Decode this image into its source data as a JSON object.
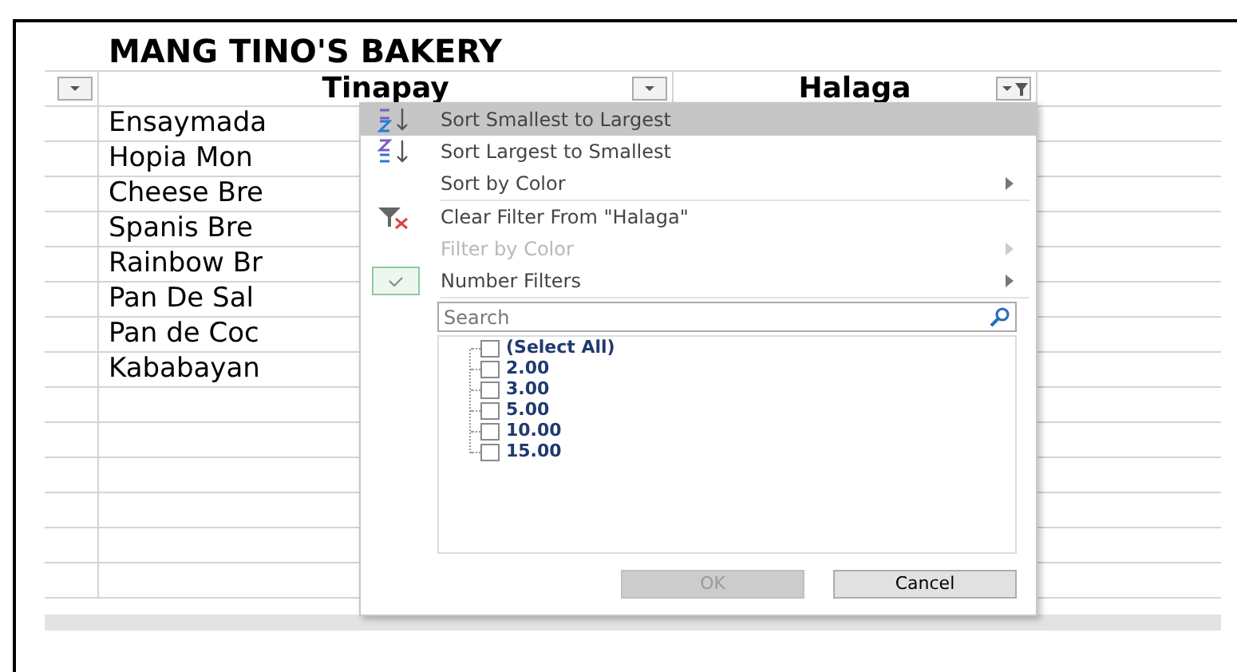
{
  "sheet": {
    "title": "MANG TINO'S BAKERY",
    "columns": [
      {
        "filtered": false
      },
      {
        "label": "Tinapay",
        "filtered": false
      },
      {
        "label": "Halaga",
        "filtered": true
      }
    ],
    "rows": [
      "Ensaymada",
      "Hopia Mon",
      "Cheese Bre",
      "Spanis Bre",
      "Rainbow Br",
      "Pan De Sal",
      "Pan de Coc",
      "Kababayan"
    ]
  },
  "filter_menu": {
    "items": [
      {
        "kind": "sort_asc",
        "label": "Sort Smallest to Largest",
        "selected": true,
        "disabled": false
      },
      {
        "kind": "sort_desc",
        "label": "Sort Largest to Smallest",
        "selected": false,
        "disabled": false
      },
      {
        "kind": "submenu",
        "label": "Sort by Color",
        "selected": false,
        "disabled": false
      },
      {
        "kind": "clear",
        "label": "Clear Filter From \"Halaga\"",
        "selected": false,
        "disabled": false
      },
      {
        "kind": "submenu",
        "label": "Filter by Color",
        "selected": false,
        "disabled": true
      },
      {
        "kind": "checked_submenu",
        "label": "Number Filters",
        "selected": false,
        "disabled": false
      }
    ],
    "search": {
      "placeholder": "Search"
    },
    "values": [
      {
        "label": "(Select All)",
        "checked": false
      },
      {
        "label": "2.00",
        "checked": false
      },
      {
        "label": "3.00",
        "checked": false
      },
      {
        "label": "5.00",
        "checked": false
      },
      {
        "label": "10.00",
        "checked": false
      },
      {
        "label": "15.00",
        "checked": false
      }
    ],
    "buttons": [
      {
        "label": "OK",
        "disabled": true
      },
      {
        "label": "Cancel",
        "disabled": false
      }
    ]
  }
}
